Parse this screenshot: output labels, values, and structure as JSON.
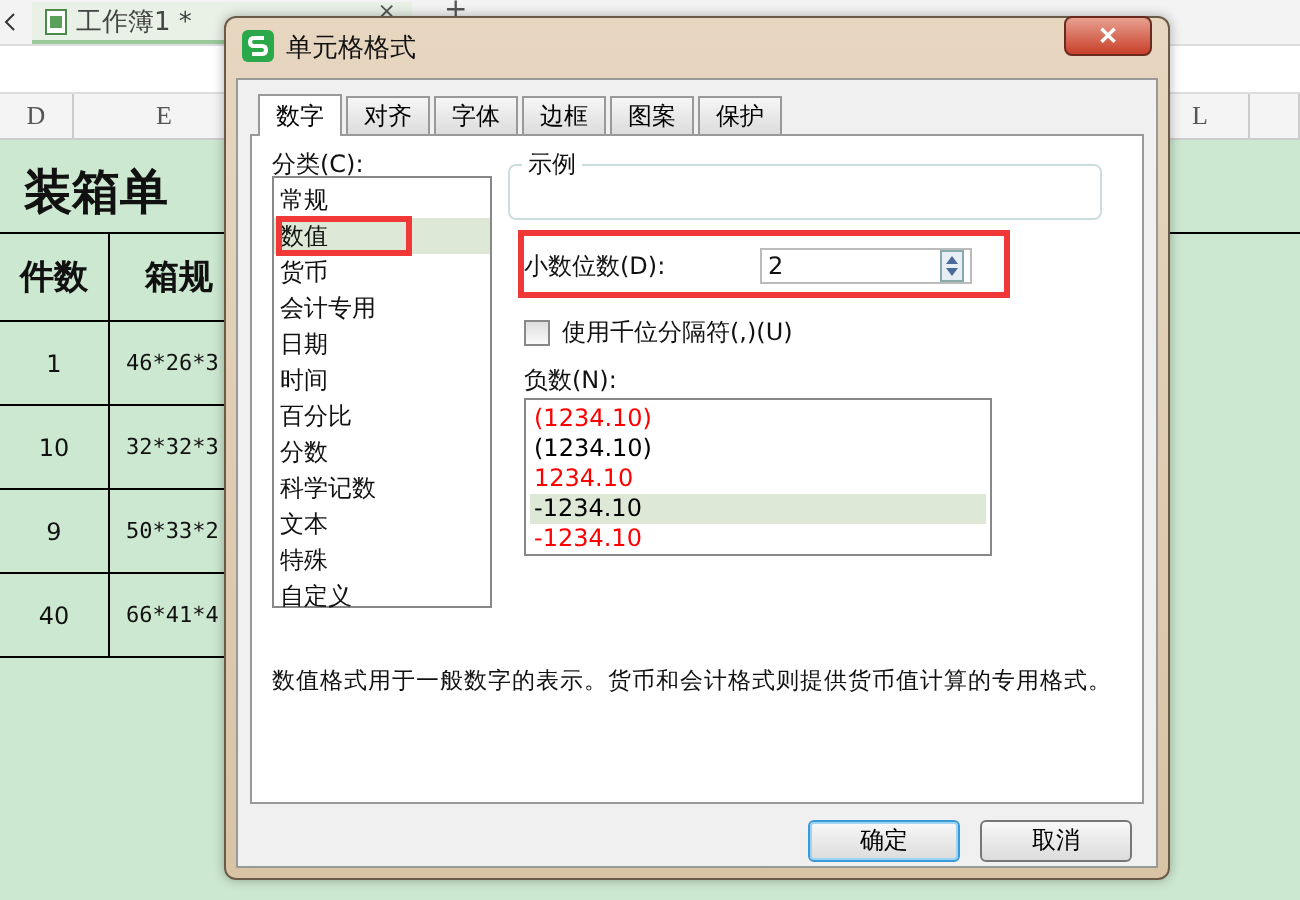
{
  "workbook_tab": {
    "title": "工作簿1 *",
    "close": "×",
    "add": "+"
  },
  "column_headers": [
    "D",
    "E",
    "L"
  ],
  "sheet": {
    "title": "装箱单",
    "headers": [
      "件数",
      "箱规"
    ],
    "rows": [
      [
        "1",
        "46*26*3"
      ],
      [
        "10",
        "32*32*3"
      ],
      [
        "9",
        "50*33*2"
      ],
      [
        "40",
        "66*41*4"
      ]
    ]
  },
  "dialog": {
    "title": "单元格格式",
    "close": "✕",
    "tabs": [
      {
        "label": "数字",
        "selected": true
      },
      {
        "label": "对齐",
        "selected": false
      },
      {
        "label": "字体",
        "selected": false
      },
      {
        "label": "边框",
        "selected": false
      },
      {
        "label": "图案",
        "selected": false
      },
      {
        "label": "保护",
        "selected": false
      }
    ],
    "category_label": "分类(C):",
    "categories": [
      {
        "label": "常规",
        "selected": false
      },
      {
        "label": "数值",
        "selected": true,
        "highlighted": true
      },
      {
        "label": "货币",
        "selected": false
      },
      {
        "label": "会计专用",
        "selected": false
      },
      {
        "label": "日期",
        "selected": false
      },
      {
        "label": "时间",
        "selected": false
      },
      {
        "label": "百分比",
        "selected": false
      },
      {
        "label": "分数",
        "selected": false
      },
      {
        "label": "科学记数",
        "selected": false
      },
      {
        "label": "文本",
        "selected": false
      },
      {
        "label": "特殊",
        "selected": false
      },
      {
        "label": "自定义",
        "selected": false
      }
    ],
    "sample_label": "示例",
    "decimal_places": {
      "label": "小数位数(D):",
      "value": "2",
      "highlighted": true
    },
    "thousands_separator": {
      "label": "使用千位分隔符(,)(U)",
      "checked": false
    },
    "negative_label": "负数(N):",
    "negative_formats": [
      {
        "label": "(1234.10)",
        "color": "#ff0000",
        "selected": false
      },
      {
        "label": "(1234.10)",
        "color": "#000000",
        "selected": false
      },
      {
        "label": "1234.10",
        "color": "#ff0000",
        "selected": false
      },
      {
        "label": "-1234.10",
        "color": "#000000",
        "selected": true
      },
      {
        "label": "-1234.10",
        "color": "#ff0000",
        "selected": false
      }
    ],
    "description": "数值格式用于一般数字的表示。货币和会计格式则提供货币值计算的专用格式。",
    "buttons": [
      "确定",
      "取消"
    ]
  }
}
